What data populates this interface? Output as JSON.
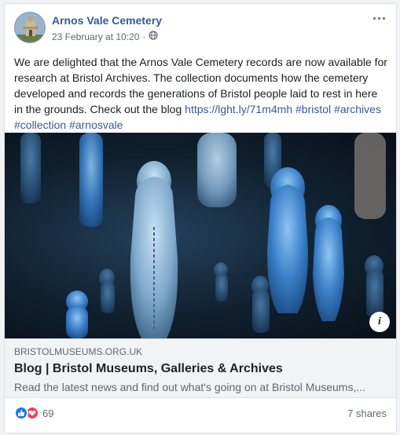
{
  "post": {
    "page_name": "Arnos Vale Cemetery",
    "timestamp": "23 February at 10:20",
    "separator": "·",
    "audience_icon": "globe-icon",
    "text_main": "We are delighted that the Arnos Vale Cemetery records are now available for research at Bristol Archives. The collection documents how the cemetery developed and records the generations of Bristol people laid to rest in here in the grounds. Check out the blog ",
    "link_url": "https://lght.ly/71m4mh",
    "hashtags": [
      "#bristol",
      "#archives",
      "#collection",
      "#arnosvale"
    ]
  },
  "link_preview": {
    "domain": "BRISTOLMUSEUMS.ORG.UK",
    "title": "Blog | Bristol Museums, Galleries & Archives",
    "description": "Read the latest news and find out what's going on at Bristol Museums,..."
  },
  "footer": {
    "reaction_count": "69",
    "shares": "7 shares"
  },
  "colors": {
    "link": "#385898",
    "like": "#1877f2",
    "love": "#f33e58",
    "figurine_blue": "#3a7fc9"
  }
}
